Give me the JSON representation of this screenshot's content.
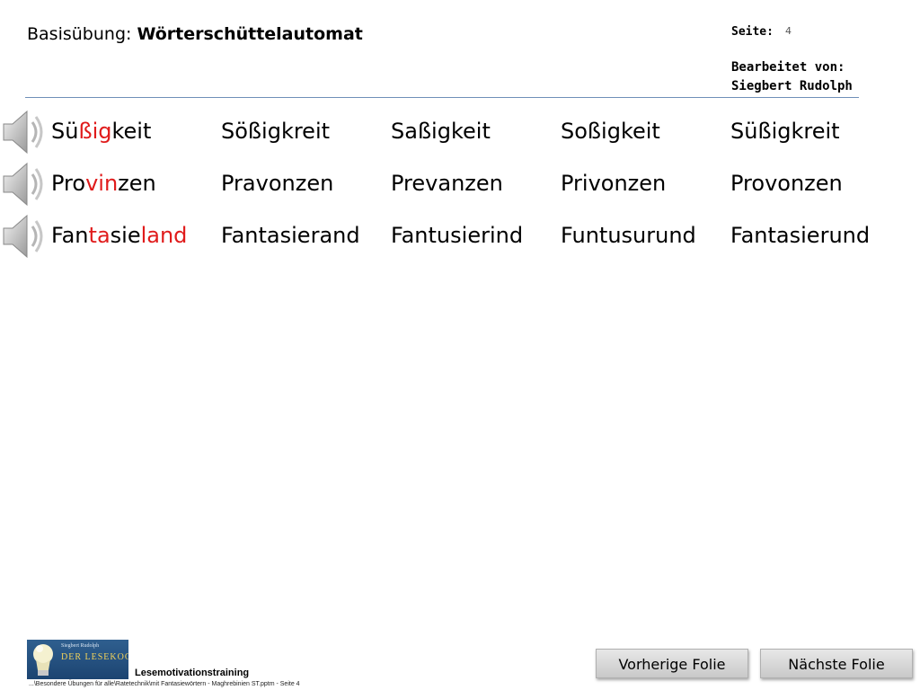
{
  "header": {
    "title_prefix": "Basisübung: ",
    "title_main": "Wörterschüttelautomat",
    "page_label": "Seite:",
    "page_number": "4",
    "edited_label": "Bearbeitet von:",
    "edited_name": "Siegbert Rudolph"
  },
  "rows": [
    {
      "target_parts": [
        {
          "text": "Sü",
          "highlight": false
        },
        {
          "text": "ßig",
          "highlight": true
        },
        {
          "text": "keit",
          "highlight": false
        }
      ],
      "variants": [
        "Sößigkreit",
        "Saßigkeit",
        "Soßigkeit",
        "Süßigkreit"
      ]
    },
    {
      "target_parts": [
        {
          "text": "Pro",
          "highlight": false
        },
        {
          "text": "vin",
          "highlight": true
        },
        {
          "text": "zen",
          "highlight": false
        }
      ],
      "variants": [
        "Pravonzen",
        "Prevanzen",
        "Privonzen",
        "Provonzen"
      ]
    },
    {
      "target_parts": [
        {
          "text": "Fan",
          "highlight": false
        },
        {
          "text": "ta",
          "highlight": true
        },
        {
          "text": "sie",
          "highlight": false
        },
        {
          "text": "land",
          "highlight": true
        }
      ],
      "variants": [
        "Fantasierand",
        "Fantusierind",
        "Funtusurund",
        "Fantasierund"
      ]
    }
  ],
  "colors": {
    "highlight": "#e01b1b",
    "rule": "#6f8fb8"
  },
  "icons": {
    "row_icon": "speaker-icon"
  },
  "logo": {
    "line1": "Siegbert Rudolph",
    "line2": "DER LESEKOCH"
  },
  "footer": {
    "label": "Lesemotivationstraining",
    "path": "...\\Besondere Übungen für alle\\Ratetechnik\\mit Fantasiewörtern - Maghrebinien ST.pptm - Seite 4"
  },
  "nav": {
    "prev": "Vorherige Folie",
    "next": "Nächste Folie"
  }
}
